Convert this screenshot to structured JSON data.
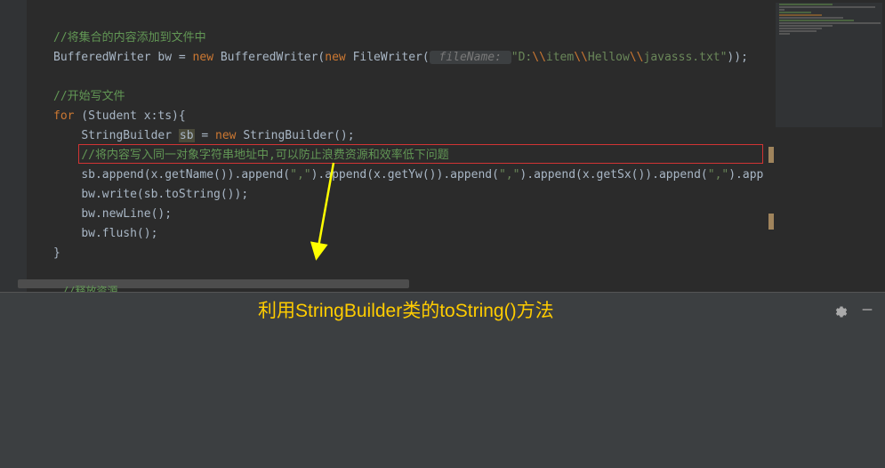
{
  "code": {
    "line1_comment": "//将集合的内容添加到文件中",
    "line2_type1": "BufferedWriter",
    "line2_var": "bw",
    "line2_eq": " = ",
    "line2_new": "new",
    "line2_type2": " BufferedWriter(",
    "line2_new2": "new",
    "line2_type3": " FileWriter(",
    "line2_hint": " fileName: ",
    "line2_str1": "\"D:",
    "line2_esc1": "\\\\",
    "line2_str2": "item",
    "line2_esc2": "\\\\",
    "line2_str3": "Hellow",
    "line2_esc3": "\\\\",
    "line2_str4": "javasss.txt\"",
    "line2_end": "));",
    "line4_comment": "//开始写文件",
    "line5_for": "for",
    "line5_rest": " (Student x:ts){",
    "line6_type": "StringBuilder ",
    "line6_var": "sb",
    "line6_eq": " = ",
    "line6_new": "new",
    "line6_rest": " StringBuilder();",
    "line7_comment": "//将内容写入同一对象字符串地址中,可以防止浪费资源和效率低下问题",
    "line8_p1": "sb.append(x.getName()).append(",
    "line8_s1": "\",\"",
    "line8_p2": ").append(x.getYw()).append(",
    "line8_s2": "\",\"",
    "line8_p3": ").append(x.getSx()).append(",
    "line8_s3": "\",\"",
    "line8_p4": ").app",
    "line9": "bw.write(sb.toString());",
    "line10": "bw.newLine();",
    "line11": "bw.flush();",
    "line12": "}",
    "line14_comment": "//释放资源"
  },
  "annotation": "利用StringBuilder类的toString()方法"
}
